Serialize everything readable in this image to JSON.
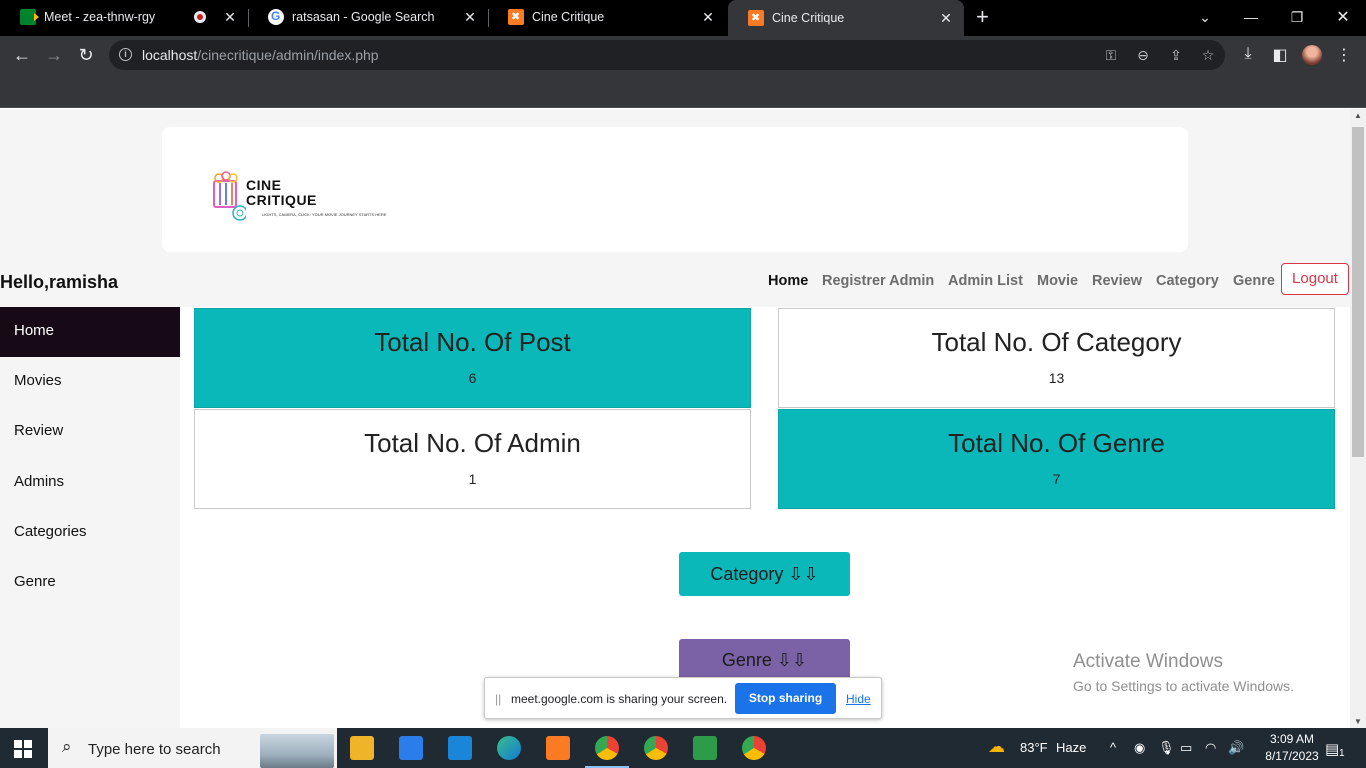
{
  "browser": {
    "tabs": [
      {
        "title": "Meet - zea-thnw-rgy",
        "icon": "google-meet-icon",
        "recording": true,
        "active": false
      },
      {
        "title": "ratsasan - Google Search",
        "icon": "google-icon",
        "active": false
      },
      {
        "title": "Cine Critique",
        "icon": "xampp-icon",
        "active": false
      },
      {
        "title": "Cine Critique",
        "icon": "xampp-icon",
        "active": true
      }
    ],
    "url_host": "localhost",
    "url_path": "/cinecritique/admin/index.php"
  },
  "site": {
    "logo_line1": "CINE",
    "logo_line2": "CRITIQUE",
    "logo_tagline": "LIGHTS, CAMERA, CLICK: YOUR MOVIE JOURNEY STARTS HERE",
    "greeting": "Hello,ramisha",
    "nav": [
      "Home",
      "Registrer Admin",
      "Admin List",
      "Movie",
      "Review",
      "Category",
      "Genre"
    ],
    "logout_label": "Logout",
    "sidebar": [
      "Home",
      "Movies",
      "Review",
      "Admins",
      "Categories",
      "Genre"
    ],
    "cards": [
      {
        "title": "Total No. Of Post",
        "value": "6",
        "color": "#0bb8b9"
      },
      {
        "title": "Total No. Of Category",
        "value": "13",
        "color": "#ffffff"
      },
      {
        "title": "Total No. Of Admin",
        "value": "1",
        "color": "#ffffff"
      },
      {
        "title": "Total No. Of Genre",
        "value": "7",
        "color": "#0bb8b9"
      }
    ],
    "category_button": "Category ⇩⇩",
    "genre_button": "Genre ⇩⇩"
  },
  "overlay": {
    "activate_title": "Activate Windows",
    "activate_sub": "Go to Settings to activate Windows.",
    "share_message": "meet.google.com is sharing your screen.",
    "stop_sharing": "Stop sharing",
    "hide": "Hide"
  },
  "taskbar": {
    "search_placeholder": "Type here to search",
    "weather_temp": "83°F",
    "weather_desc": "Haze",
    "time": "3:09 AM",
    "date": "8/17/2023",
    "notification_count": "1"
  },
  "colors": {
    "teal": "#0bb8b9",
    "purple": "#7b61a6",
    "sidebar_active": "#170a16",
    "logout": "#dc3545"
  }
}
